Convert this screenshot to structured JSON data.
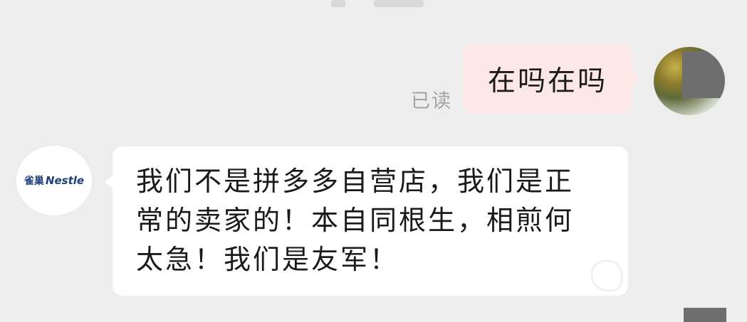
{
  "conversation": {
    "outgoing": {
      "text": "在吗在吗",
      "read_status": "已读"
    },
    "incoming": {
      "sender_logo": {
        "cn": "雀巢",
        "en": "Nestle"
      },
      "lines": [
        "我们不是拼多多自营店，我们是正",
        "常的卖家的！本自同根生，相煎何",
        "太急！我们是友军！"
      ]
    }
  },
  "colors": {
    "background": "#ededed",
    "outgoing_bubble": "#fbe7e5",
    "incoming_bubble": "#ffffff",
    "read_status": "#a3a3a3",
    "brand_blue": "#1e3f7a"
  }
}
